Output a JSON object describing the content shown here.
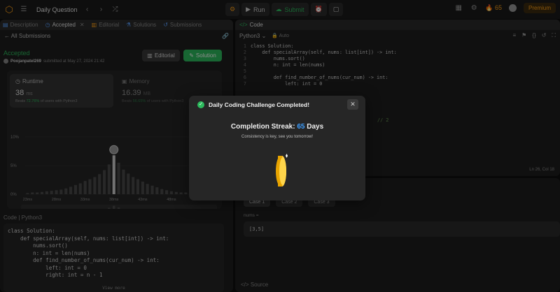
{
  "topbar": {
    "title": "Daily Question",
    "run_label": "Run",
    "submit_label": "Submit",
    "streak_count": "65",
    "premium_label": "Premium"
  },
  "left_tabs": [
    {
      "label": "Description"
    },
    {
      "label": "Accepted"
    },
    {
      "label": "Editorial"
    },
    {
      "label": "Solutions"
    },
    {
      "label": "Submissions"
    }
  ],
  "submission": {
    "back_label": "All Submissions",
    "status": "Accepted",
    "author": "Poojanpatel269",
    "submitted_text": "submitted at May 27, 2024 21:42",
    "editorial_button": "Editorial",
    "solution_button": "Solution"
  },
  "runtime": {
    "label": "Runtime",
    "value": "38",
    "unit": "ms",
    "beats_prefix": "Beats",
    "beats_pct": "72.76%",
    "beats_suffix": "of users with Python3"
  },
  "memory": {
    "label": "Memory",
    "value": "16.39",
    "unit": "MB",
    "beats_prefix": "Beats",
    "beats_pct": "56.65%",
    "beats_suffix": "of users with Python3"
  },
  "chart_data": {
    "type": "bar",
    "title": "",
    "y_tick_labels": [
      "10%",
      "5%",
      "0%"
    ],
    "ylim": [
      0,
      10
    ],
    "categories": [
      "23ms",
      "",
      "",
      "",
      "",
      "",
      "28ms",
      "",
      "",
      "",
      "",
      "",
      "33ms",
      "",
      "",
      "",
      "",
      "",
      "38ms",
      "",
      "",
      "",
      "",
      "",
      "43ms",
      "",
      "",
      "",
      "",
      "",
      "48ms",
      "",
      "",
      "",
      "",
      "",
      "53ms",
      "",
      "",
      ""
    ],
    "x_tick_labels": [
      "23ms",
      "28ms",
      "33ms",
      "38ms",
      "43ms",
      "48ms",
      "53ms"
    ],
    "values": [
      0.2,
      0.3,
      0.3,
      0.4,
      0.5,
      0.6,
      0.7,
      0.8,
      1.0,
      1.3,
      1.6,
      1.9,
      2.3,
      2.6,
      3.0,
      3.5,
      4.2,
      5.2,
      6.8,
      5.5,
      4.3,
      3.6,
      3.0,
      2.6,
      2.2,
      1.8,
      1.5,
      1.2,
      0.9,
      0.7,
      0.5,
      0.4,
      0.3,
      0.3,
      0.2,
      0.2,
      0.2,
      0.2,
      0.2,
      0.2
    ],
    "highlight_index": 18,
    "mini_tick_labels": [
      "23ms",
      "28ms",
      "33ms",
      "38ms",
      "43ms",
      "48ms",
      "53ms"
    ]
  },
  "code_panel": {
    "header": "Code",
    "language": "Python3",
    "lines": [
      "class Solution:",
      "    def specialArray(self, nums: list[int]) -> int:",
      "        nums.sort()",
      "        n: int = len(nums)",
      "",
      "        def find_number_of_nums(cur_num) -> int:",
      "            left: int = 0",
      "            right: int = n - 1"
    ],
    "view_more": "View more"
  },
  "editor": {
    "tab_label": "Code",
    "language": "Python3",
    "auto_label": "Auto",
    "line_numbers": [
      "1",
      "2",
      "3",
      "4",
      "5",
      "6",
      "7"
    ],
    "lines": [
      "class Solution:",
      "    def specialArray(self, nums: list[int]) -> int:",
      "        nums.sort()",
      "        n: int = len(nums)",
      "",
      "        def find_number_of_nums(cur_num) -> int:",
      "            left: int = 0"
    ],
    "fragment": "// 2",
    "cursor": "Ln 26, Col 18"
  },
  "testcase": {
    "cases": [
      "Case 1",
      "Case 2",
      "Case 3"
    ],
    "input_label": "nums =",
    "input_value": "[3,5]",
    "source_label": "Source"
  },
  "modal": {
    "title": "Daily Coding Challenge Completed!",
    "streak_label": "Completion Streak:",
    "streak_value": "65",
    "streak_unit": "Days",
    "subtitle": "Consistency is key, see you tomorrow!"
  },
  "colors": {
    "accent_green": "#2cbb5d",
    "accent_orange": "#ffa116",
    "streak_blue": "#3d9eff"
  }
}
